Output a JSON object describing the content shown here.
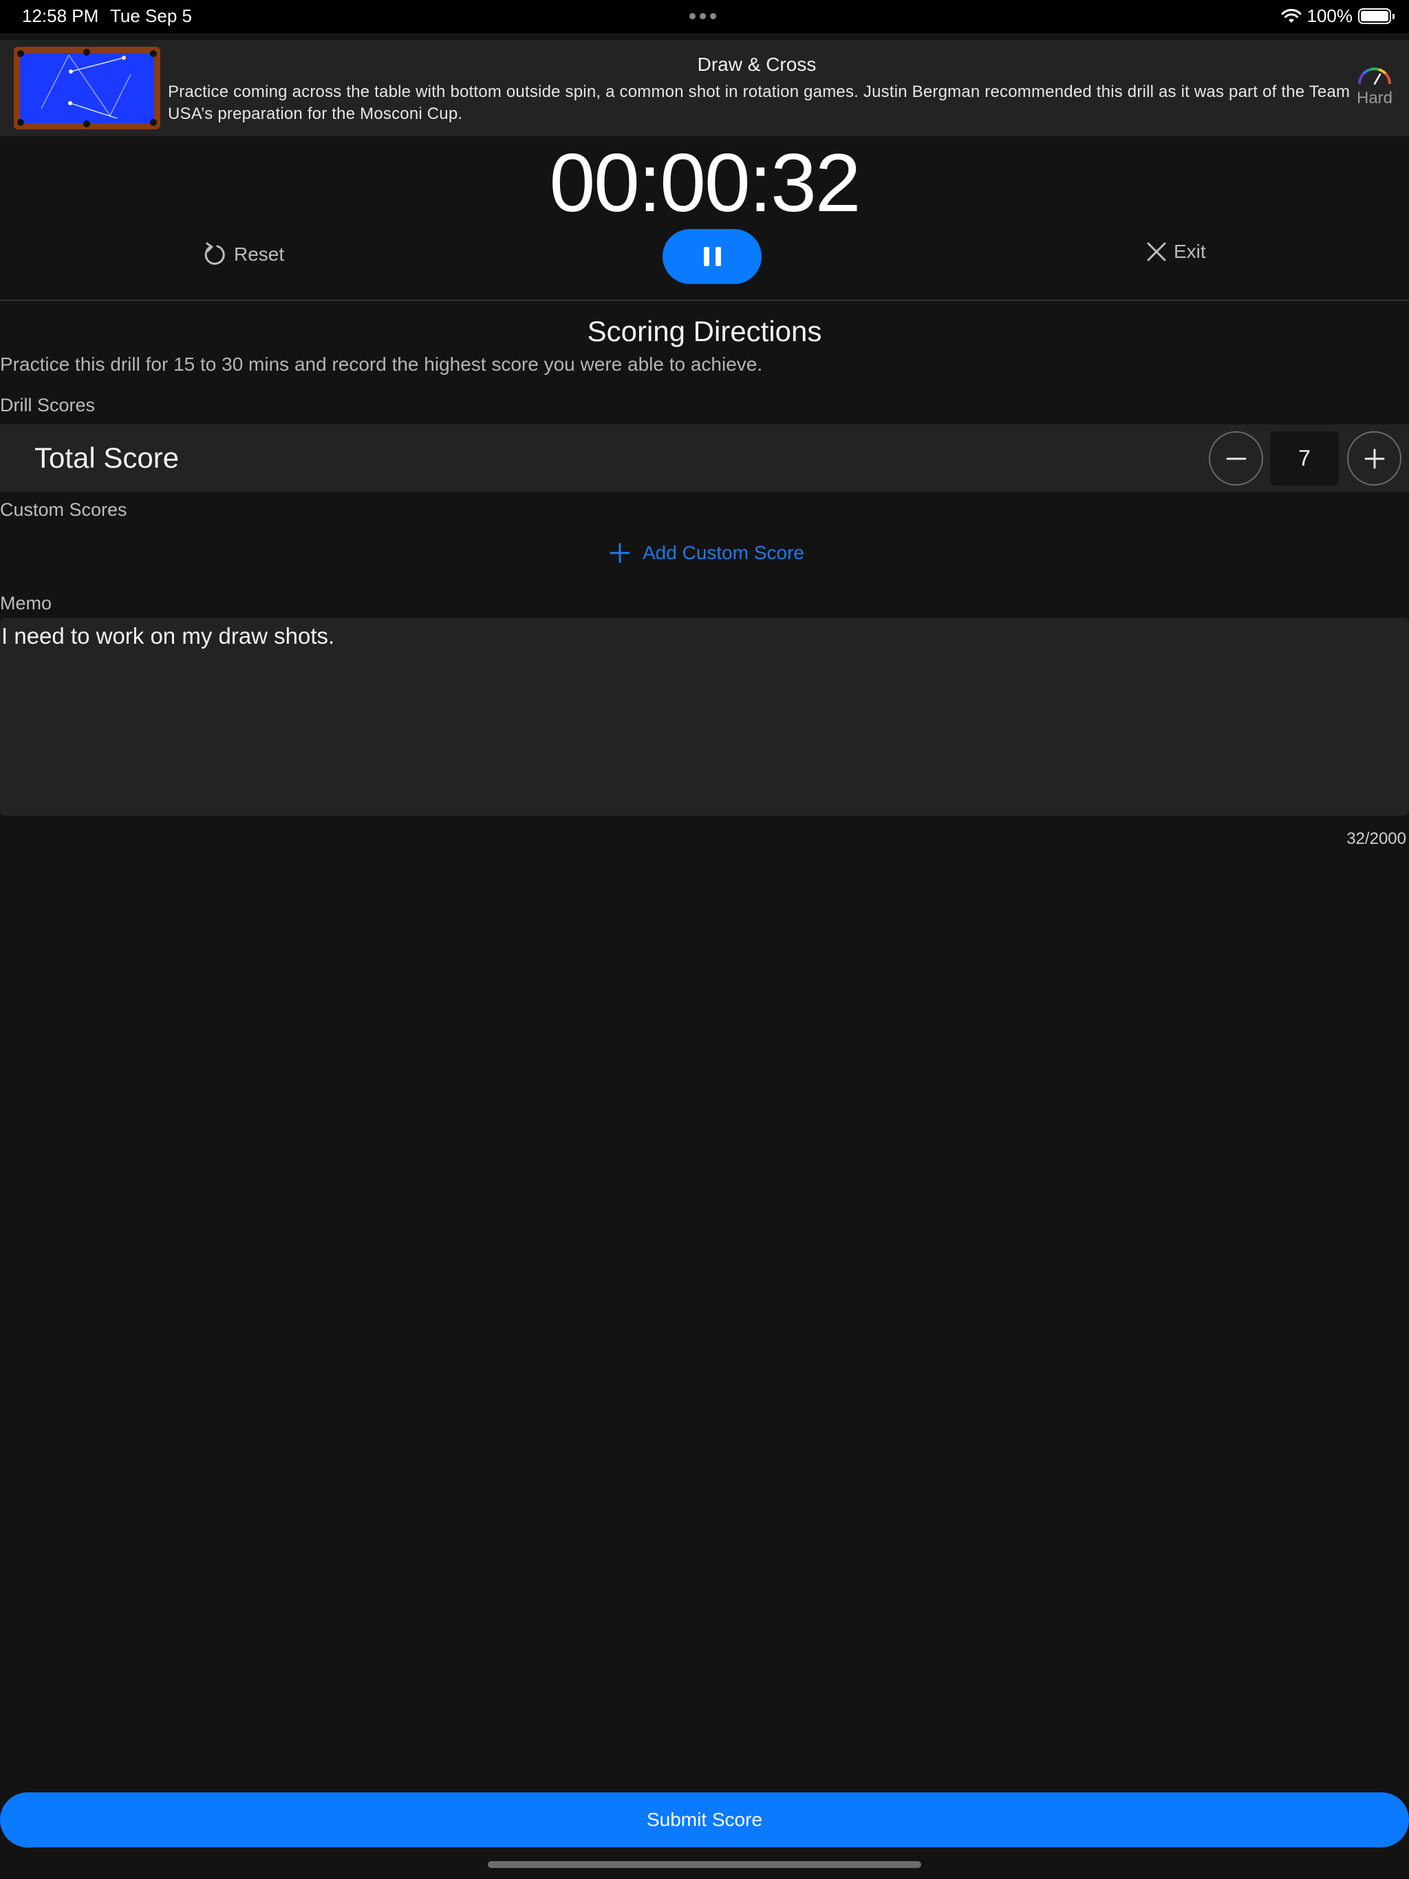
{
  "status_bar": {
    "time": "12:58 PM",
    "date": "Tue Sep 5",
    "battery": "100%"
  },
  "drill": {
    "title": "Draw & Cross",
    "description": "Practice coming across the table with bottom outside spin, a common shot in rotation games. Justin Bergman recommended this drill as it was part of the Team USA’s preparation for the Mosconi Cup.",
    "difficulty": "Hard"
  },
  "timer": {
    "display": "00:00:32",
    "reset_label": "Reset",
    "exit_label": "Exit"
  },
  "scoring": {
    "title": "Scoring Directions",
    "directions": "Practice this drill for 15 to 30 mins and record the highest score you were able to achieve.",
    "drill_scores_label": "Drill Scores",
    "total_score_label": "Total Score",
    "total_score_value": "7",
    "custom_scores_label": "Custom Scores",
    "add_custom_label": "Add Custom Score"
  },
  "memo": {
    "label": "Memo",
    "text": "I need to work on my draw shots.",
    "char_count": "32/2000"
  },
  "submit_label": "Submit Score",
  "colors": {
    "accent": "#0a7aff",
    "background": "#131313",
    "panel": "#232323",
    "table_felt": "#1a3bff",
    "table_rail": "#8a3d10"
  }
}
